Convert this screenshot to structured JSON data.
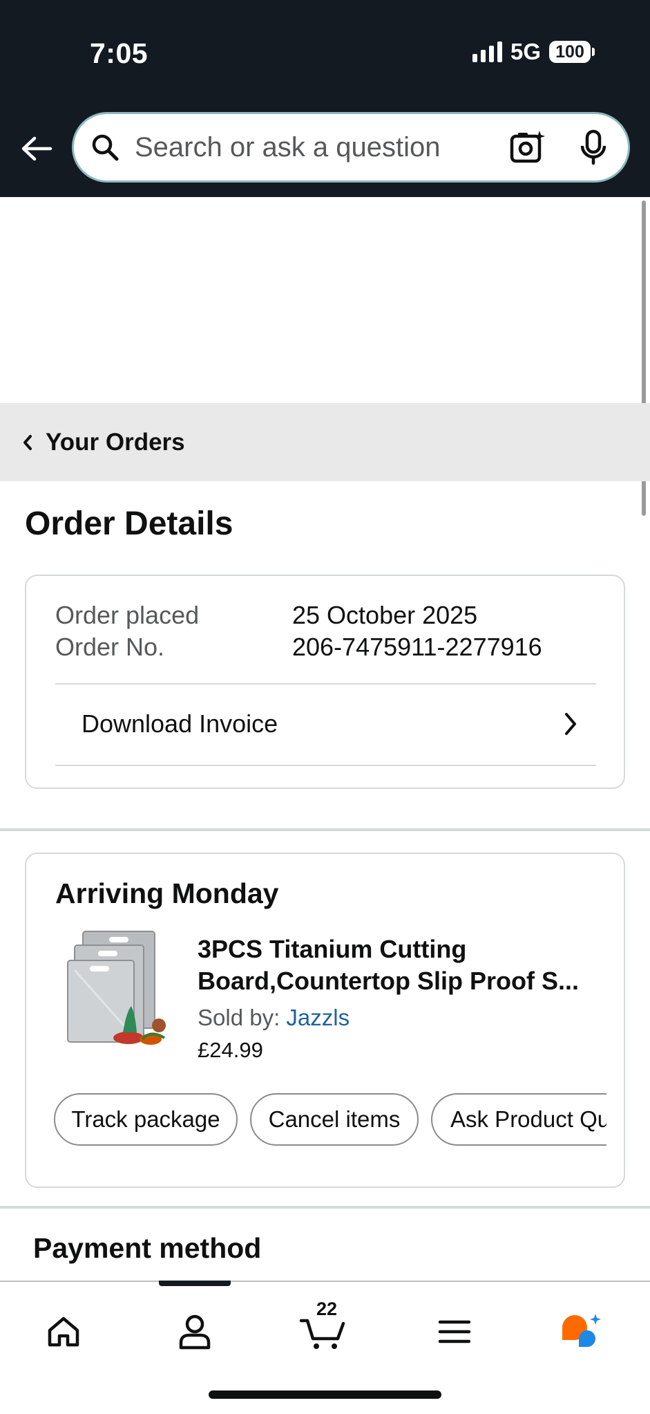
{
  "status_bar": {
    "time": "7:05",
    "network": "5G",
    "battery": "100"
  },
  "header": {
    "search_placeholder": "Search or ask a question",
    "icons": [
      "back-arrow-icon",
      "search-icon",
      "camera-lens-icon",
      "microphone-icon"
    ]
  },
  "breadcrumb": {
    "label": "Your Orders"
  },
  "page": {
    "title": "Order Details"
  },
  "order_info": {
    "placed_label": "Order placed",
    "placed_value": "25 October 2025",
    "number_label": "Order No.",
    "number_value": "206-7475911-2277916",
    "invoice_label": "Download Invoice"
  },
  "shipment": {
    "status": "Arriving Monday",
    "product_title_line1": "3PCS Titanium Cutting",
    "product_title_line2": "Board,Countertop Slip Proof S...",
    "sold_by_label": "Sold by: ",
    "seller": "Jazzls",
    "price": "£24.99",
    "actions": [
      "Track package",
      "Cancel items",
      "Ask Product Qu"
    ]
  },
  "payment": {
    "title": "Payment method"
  },
  "bottom_nav": {
    "items": [
      "home-icon",
      "account-icon",
      "cart-icon",
      "menu-icon",
      "rufus-assistant-icon"
    ],
    "cart_count": "22",
    "accent_color": "#ff6a00",
    "assistant_blue": "#1e88e5"
  },
  "colors": {
    "header_bg": "#131a22",
    "link": "#2162a1",
    "breadcrumb_bg": "#e9e9e9"
  }
}
